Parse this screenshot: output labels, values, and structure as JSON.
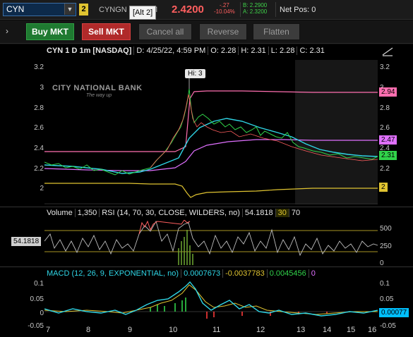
{
  "topbar": {
    "symbol": "CYN",
    "link_badge": "2",
    "description": "CYNGN",
    "description_tail": "M",
    "alt_tooltip": "[Alt 2]",
    "last": "2.4200",
    "change": "-.27",
    "change_pct": "-10.04%",
    "bid": "B: 2.2900",
    "ask": "A: 2.3200",
    "net_pos": "Net Pos: 0"
  },
  "orderbar": {
    "expander": "›",
    "buy": "Buy MKT",
    "sell": "Sell MKT",
    "cancel_all": "Cancel all",
    "reverse": "Reverse",
    "flatten": "Flatten"
  },
  "chart_header": {
    "symbol": "CYN 1 D 1m [NASDAQ]",
    "date": "D: 4/25/22, 4:59 PM",
    "open": "O: 2.28",
    "high": "H: 2.31",
    "low": "L: 2.28",
    "close": "C: 2.31"
  },
  "price_axis": {
    "labels_right": [
      "3.2",
      "3",
      "2.8",
      "2.6",
      "2.4",
      "2.2"
    ],
    "labels_left": [
      "3.2",
      "3",
      "2.8",
      "2.6",
      "2.4",
      "2.2",
      "2"
    ],
    "tags": [
      {
        "value": "2.94",
        "color": "#ff6fb0"
      },
      {
        "value": "2.47",
        "color": "#e070ff"
      },
      {
        "value": "2.31",
        "color": "#31d34a"
      },
      {
        "value": "2",
        "color": "#e0c431"
      }
    ]
  },
  "hi_tag": "Hi: 3",
  "logo": {
    "name": "CITY NATIONAL BANK",
    "tagline": "The way up"
  },
  "volume_header": {
    "label": "Volume",
    "value": "1,350",
    "rsi": "RSI (14, 70, 30, CLOSE, WILDERS, no)",
    "rsi_value": "54.1818",
    "overbought": "30",
    "oversold": "70"
  },
  "rsi_axis": {
    "labels": [
      "500",
      "250",
      "0"
    ],
    "value_tag": "54.1818"
  },
  "macd_header": {
    "label": "MACD (12, 26, 9, EXPONENTIAL, no)",
    "value": "0.0007673",
    "avg": "-0.0037783",
    "diff": "0.0045456",
    "zero": "0"
  },
  "macd_axis": {
    "labels_left": [
      "0.1",
      "0.05",
      "0",
      "-0.05"
    ],
    "labels_right": [
      "0.1",
      "0.05",
      "0",
      "-0.05"
    ],
    "tag": "0.00077"
  },
  "x_axis": [
    "7",
    "8",
    "9",
    "10",
    "11",
    "12",
    "13",
    "14",
    "15",
    "16"
  ],
  "colors": {
    "accent": "#3fd24a",
    "down": "#ff5f5f",
    "cyan": "#2fd6e6",
    "pink": "#ff6fb0",
    "magenta": "#e070ff",
    "yellow": "#e0c431"
  }
}
